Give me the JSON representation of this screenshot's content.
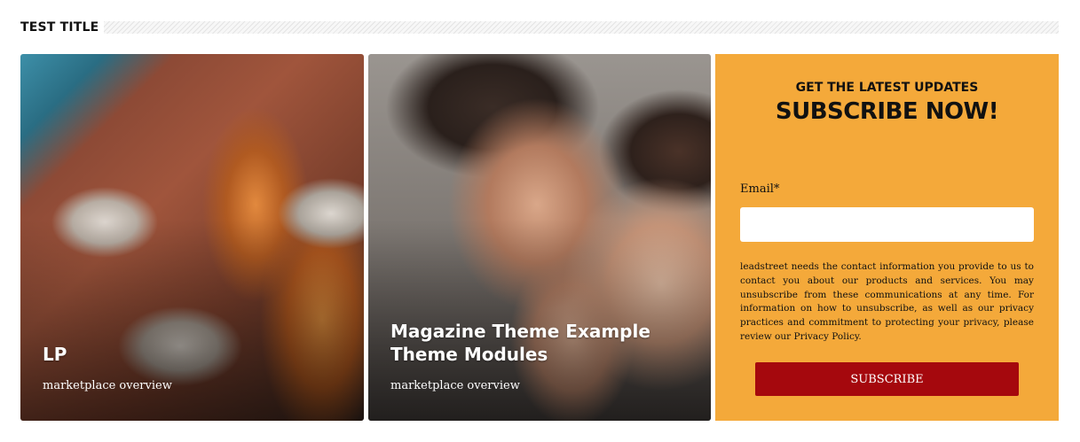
{
  "section": {
    "title": "TEST TITLE"
  },
  "cards": [
    {
      "title": "LP",
      "subtitle": "marketplace overview",
      "image": "beer-glasses-photo"
    },
    {
      "title": "Magazine Theme Example Theme Modules",
      "subtitle": "marketplace overview",
      "image": "whispering-couple-photo"
    }
  ],
  "subscribe": {
    "kicker": "GET THE LATEST UPDATES",
    "headline": "SUBSCRIBE NOW!",
    "email_label": "Email*",
    "email_value": "",
    "disclaimer": "leadstreet needs the contact information you provide to us to contact you about our products and services. You may unsubscribe from these communications at any time. For information on how to unsubscribe, as well as our privacy practices and commitment to protecting your privacy, please review our Privacy Policy.",
    "button_label": "SUBSCRIBE",
    "background_color": "#f4a93a",
    "button_color": "#a5080d"
  }
}
